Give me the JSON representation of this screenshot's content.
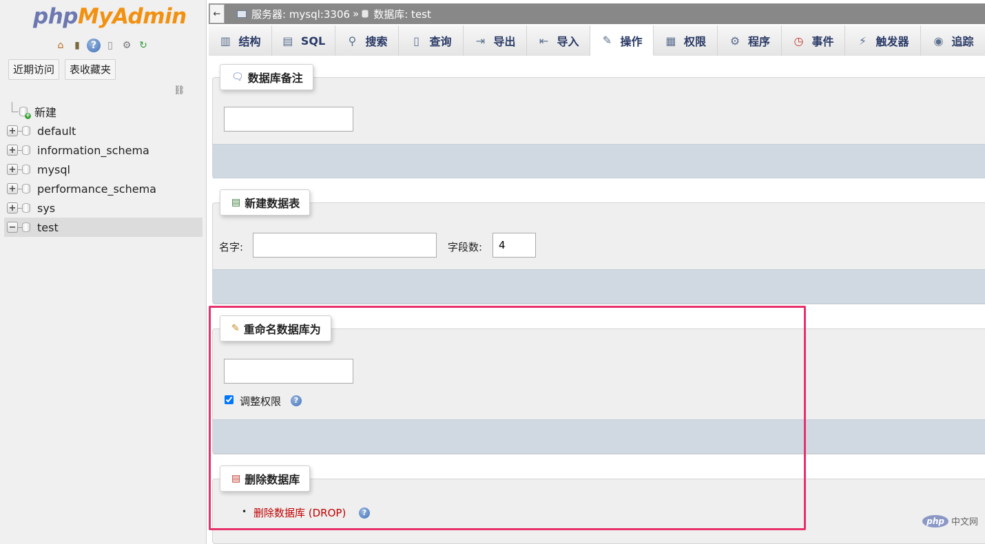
{
  "sidebar": {
    "logo": {
      "part1": "php",
      "part2": "MyAdmin"
    },
    "quick_icons": [
      "home-icon",
      "exit-icon",
      "help-icon",
      "docs-icon",
      "settings-icon",
      "reload-icon"
    ],
    "tabs": {
      "recent": "近期访问",
      "favorites": "表收藏夹"
    },
    "tree": [
      {
        "label": "新建",
        "type": "new"
      },
      {
        "label": "default",
        "type": "db"
      },
      {
        "label": "information_schema",
        "type": "db"
      },
      {
        "label": "mysql",
        "type": "db"
      },
      {
        "label": "performance_schema",
        "type": "db"
      },
      {
        "label": "sys",
        "type": "db"
      },
      {
        "label": "test",
        "type": "db",
        "active": true
      }
    ]
  },
  "topbar": {
    "back": "←",
    "server": "服务器: mysql:3306",
    "sep": "»",
    "database": "数据库: test"
  },
  "tabs": [
    {
      "label": "结构",
      "icon": "structure-icon",
      "glyph": "📊"
    },
    {
      "label": "SQL",
      "icon": "sql-icon",
      "glyph": "▤"
    },
    {
      "label": "搜索",
      "icon": "search-icon",
      "glyph": "🔍"
    },
    {
      "label": "查询",
      "icon": "query-icon",
      "glyph": "▥"
    },
    {
      "label": "导出",
      "icon": "export-icon",
      "glyph": "⇥"
    },
    {
      "label": "导入",
      "icon": "import-icon",
      "glyph": "⇤"
    },
    {
      "label": "操作",
      "icon": "wrench-icon",
      "glyph": "🔧",
      "active": true
    },
    {
      "label": "权限",
      "icon": "privileges-icon",
      "glyph": "▦"
    },
    {
      "label": "程序",
      "icon": "routines-icon",
      "glyph": "⚙"
    },
    {
      "label": "事件",
      "icon": "clock-icon",
      "glyph": "◷"
    },
    {
      "label": "触发器",
      "icon": "triggers-icon",
      "glyph": "⚡"
    },
    {
      "label": "追踪",
      "icon": "eye-icon",
      "glyph": "👁"
    }
  ],
  "sections": {
    "comment": {
      "title": "数据库备注",
      "value": ""
    },
    "create_table": {
      "title": "新建数据表",
      "name_label": "名字:",
      "name_value": "",
      "fields_label": "字段数:",
      "fields_value": "4"
    },
    "rename": {
      "title": "重命名数据库为",
      "value": "",
      "checkbox_label": "调整权限",
      "checked": true
    },
    "drop": {
      "title": "删除数据库",
      "link": "删除数据库 (DROP)"
    }
  },
  "watermark": {
    "badge": "php",
    "text": "中文网"
  },
  "colors": {
    "highlight": "#e8306a",
    "link": "#c00000",
    "footer_bar": "#d0d9e2"
  }
}
